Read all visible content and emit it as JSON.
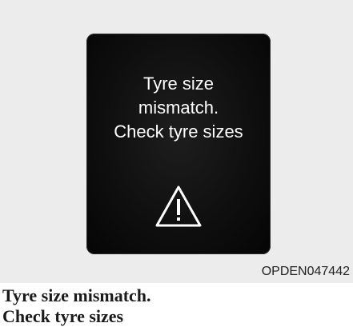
{
  "display": {
    "message_lines": [
      "Tyre size",
      "mismatch.",
      "Check tyre sizes"
    ],
    "icon": "warning-triangle-icon",
    "text_color": "#ffffff",
    "screen_color": "#0e0e0e"
  },
  "figure_code": "OPDEN047442",
  "caption": {
    "lines": [
      "Tyre size mismatch.",
      "Check tyre sizes"
    ]
  }
}
